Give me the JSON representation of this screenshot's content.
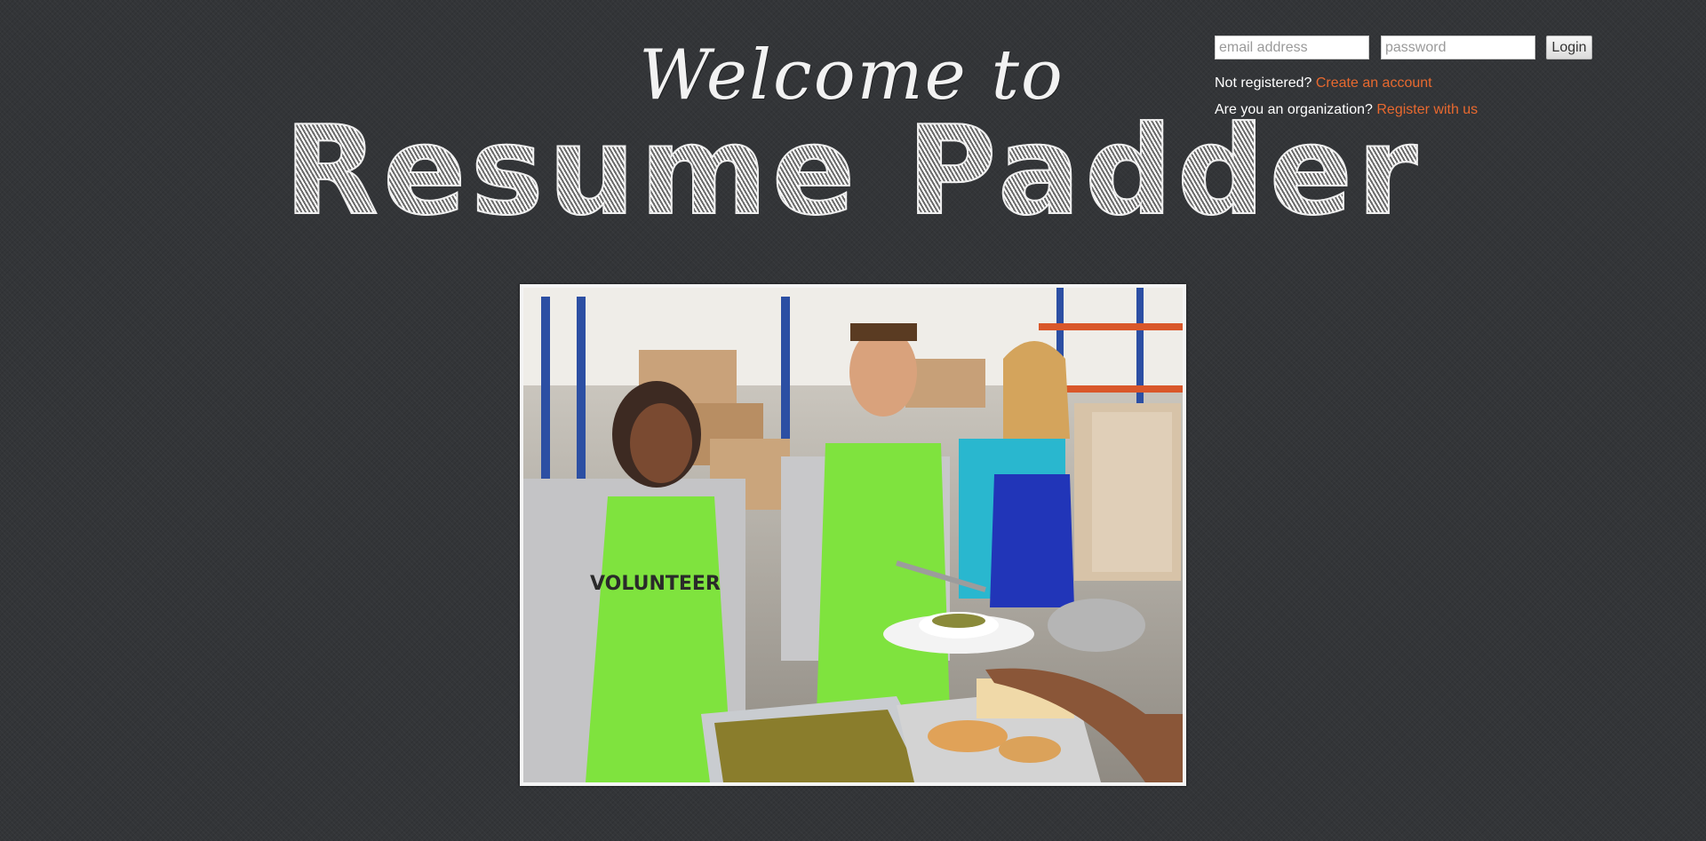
{
  "login": {
    "email_placeholder": "email address",
    "password_placeholder": "password",
    "login_label": "Login",
    "not_registered_text": "Not registered?",
    "create_account_link": "Create an account",
    "organization_text": "Are you an organization?",
    "register_link": "Register with us"
  },
  "header": {
    "welcome": "Welcome to",
    "brand": "Resume Padder"
  },
  "hero": {
    "shirt_text": "VOLUNTEER"
  },
  "colors": {
    "background": "#333538",
    "link": "#e8692f",
    "apron_green": "#7fe33e",
    "apron_blue": "#2135b8"
  }
}
